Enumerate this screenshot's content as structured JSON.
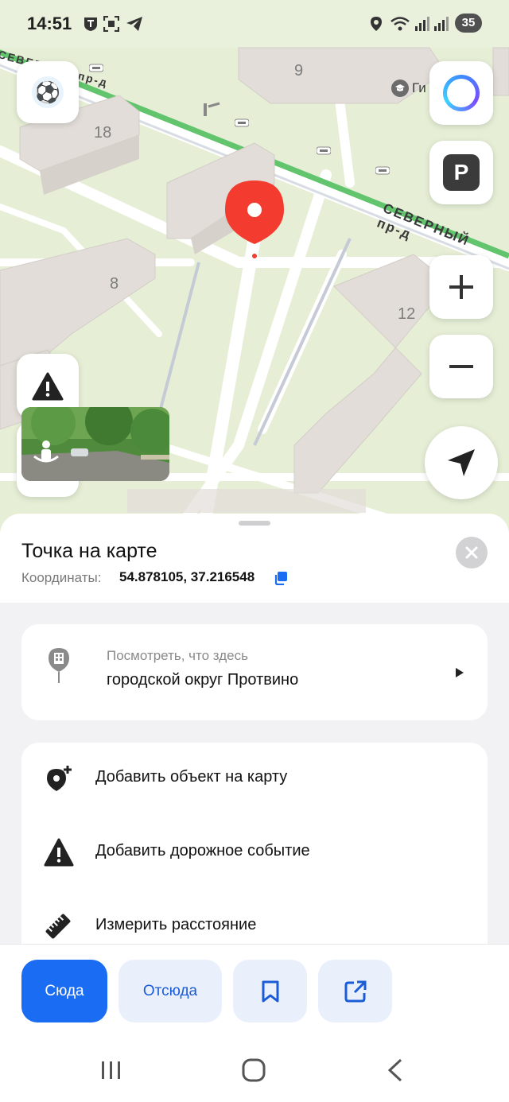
{
  "status_bar": {
    "time": "14:51",
    "battery": "35",
    "icons": [
      "shield-t-icon",
      "screenshot-icon",
      "telegram-icon",
      "location-icon",
      "wifi-icon",
      "signal-icon",
      "signal-icon"
    ]
  },
  "map": {
    "building_labels": [
      "9",
      "18",
      "8",
      "12"
    ],
    "road_label": "СЕВЕРНЫЙ пр-д",
    "road_label_top": "СЕВЕРНЫЙ пр-д",
    "poi_label": "Ги",
    "controls": [
      "football-layer-button",
      "alice-assistant-button",
      "parking-button",
      "zoom-in-button",
      "zoom-out-button",
      "road-event-button",
      "my-location-button"
    ],
    "colors": {
      "pin": "#f43b2f",
      "road_green": "#62c46c",
      "park": "#e6efd6"
    }
  },
  "sheet": {
    "title": "Точка на карте",
    "coords_label": "Координаты:",
    "coords_value": "54.878105, 37.216548",
    "lookup": {
      "sub": "Посмотреть, что здесь",
      "main": "городской округ Протвино"
    },
    "actions": [
      {
        "label": "Добавить объект на карту",
        "icon": "add-place-icon"
      },
      {
        "label": "Добавить дорожное событие",
        "icon": "warning-icon"
      },
      {
        "label": "Измерить расстояние",
        "icon": "ruler-icon"
      }
    ]
  },
  "action_bar": {
    "here": "Сюда",
    "from": "Отсюда",
    "accent": "#1a6cf2"
  }
}
